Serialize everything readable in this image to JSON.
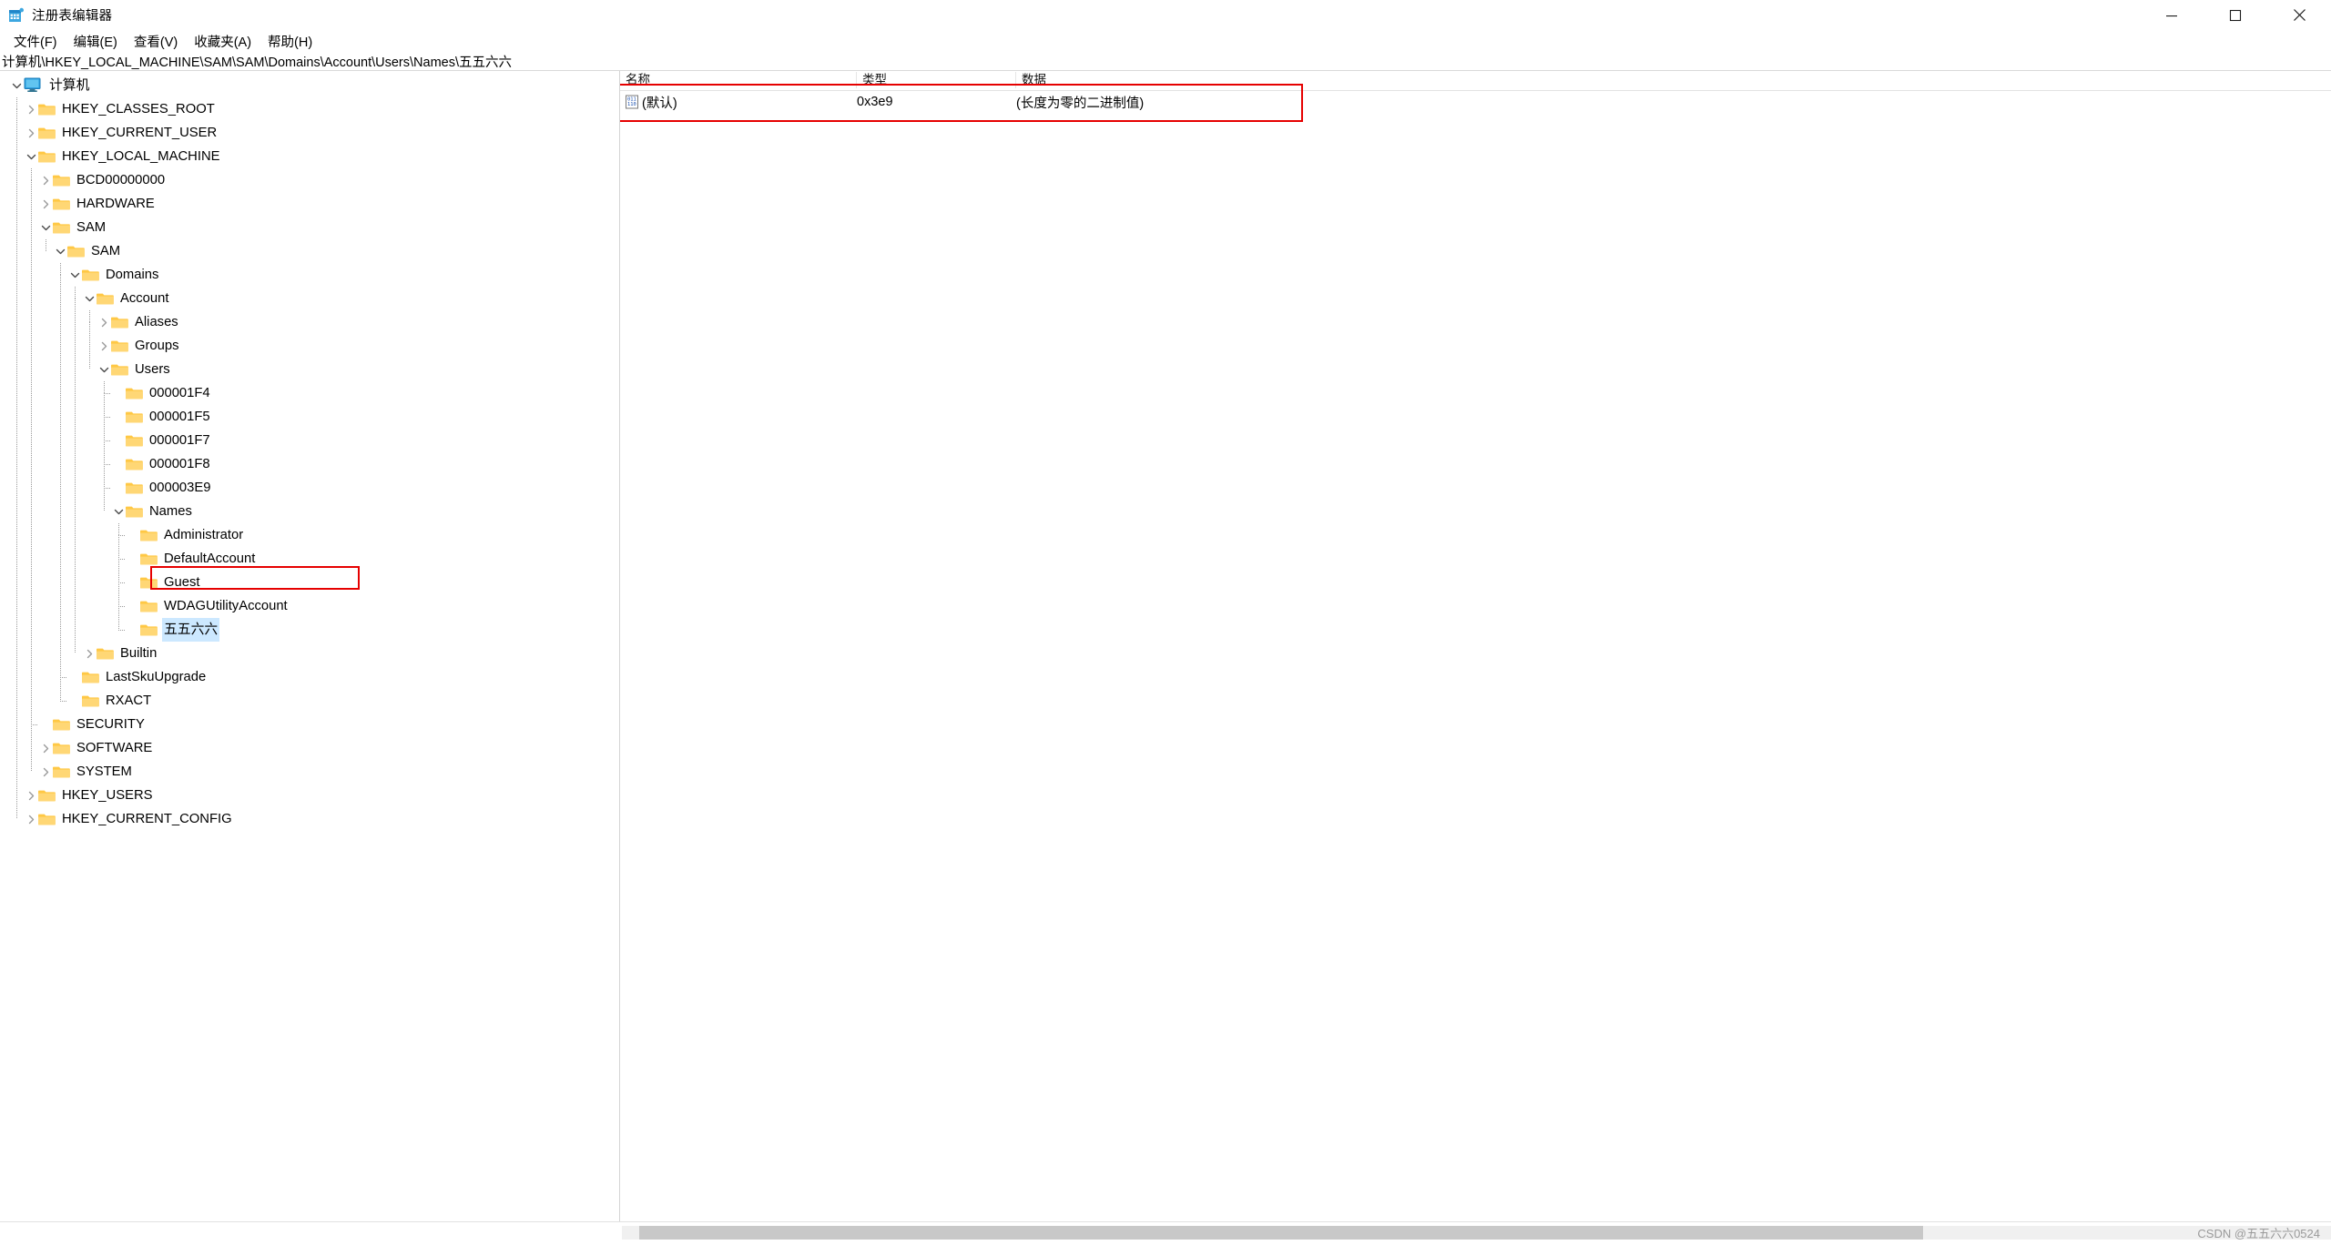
{
  "window": {
    "title": "注册表编辑器",
    "icon": "registry-editor-icon",
    "minimize_label": "─",
    "maximize_label": "☐",
    "close_label": "✕"
  },
  "menu": {
    "items": [
      {
        "label": "文件(F)",
        "name": "menu-file"
      },
      {
        "label": "编辑(E)",
        "name": "menu-edit"
      },
      {
        "label": "查看(V)",
        "name": "menu-view"
      },
      {
        "label": "收藏夹(A)",
        "name": "menu-favorites"
      },
      {
        "label": "帮助(H)",
        "name": "menu-help"
      }
    ]
  },
  "address": {
    "path": "计算机\\HKEY_LOCAL_MACHINE\\SAM\\SAM\\Domains\\Account\\Users\\Names\\五五六六"
  },
  "tree": {
    "nodes": [
      {
        "label": "计算机",
        "depth": 0,
        "state": "expanded",
        "icon": "monitor-icon",
        "selected": false
      },
      {
        "label": "HKEY_CLASSES_ROOT",
        "depth": 1,
        "state": "collapsed",
        "icon": "folder-icon",
        "selected": false
      },
      {
        "label": "HKEY_CURRENT_USER",
        "depth": 1,
        "state": "collapsed",
        "icon": "folder-icon",
        "selected": false
      },
      {
        "label": "HKEY_LOCAL_MACHINE",
        "depth": 1,
        "state": "expanded",
        "icon": "folder-icon",
        "selected": false
      },
      {
        "label": "BCD00000000",
        "depth": 2,
        "state": "collapsed",
        "icon": "folder-icon",
        "selected": false
      },
      {
        "label": "HARDWARE",
        "depth": 2,
        "state": "collapsed",
        "icon": "folder-icon",
        "selected": false
      },
      {
        "label": "SAM",
        "depth": 2,
        "state": "expanded",
        "icon": "folder-icon",
        "selected": false
      },
      {
        "label": "SAM",
        "depth": 3,
        "state": "expanded",
        "icon": "folder-icon",
        "selected": false
      },
      {
        "label": "Domains",
        "depth": 4,
        "state": "expanded",
        "icon": "folder-icon",
        "selected": false
      },
      {
        "label": "Account",
        "depth": 5,
        "state": "expanded",
        "icon": "folder-icon",
        "selected": false
      },
      {
        "label": "Aliases",
        "depth": 6,
        "state": "collapsed",
        "icon": "folder-icon",
        "selected": false
      },
      {
        "label": "Groups",
        "depth": 6,
        "state": "collapsed",
        "icon": "folder-icon",
        "selected": false
      },
      {
        "label": "Users",
        "depth": 6,
        "state": "expanded",
        "icon": "folder-icon",
        "selected": false
      },
      {
        "label": "000001F4",
        "depth": 7,
        "state": "leaf",
        "icon": "folder-icon",
        "selected": false
      },
      {
        "label": "000001F5",
        "depth": 7,
        "state": "leaf",
        "icon": "folder-icon",
        "selected": false
      },
      {
        "label": "000001F7",
        "depth": 7,
        "state": "leaf",
        "icon": "folder-icon",
        "selected": false
      },
      {
        "label": "000001F8",
        "depth": 7,
        "state": "leaf",
        "icon": "folder-icon",
        "selected": false
      },
      {
        "label": "000003E9",
        "depth": 7,
        "state": "leaf",
        "icon": "folder-icon",
        "selected": false
      },
      {
        "label": "Names",
        "depth": 7,
        "state": "expanded",
        "icon": "folder-icon",
        "selected": false
      },
      {
        "label": "Administrator",
        "depth": 8,
        "state": "leaf",
        "icon": "folder-icon",
        "selected": false
      },
      {
        "label": "DefaultAccount",
        "depth": 8,
        "state": "leaf",
        "icon": "folder-icon",
        "selected": false
      },
      {
        "label": "Guest",
        "depth": 8,
        "state": "leaf",
        "icon": "folder-icon",
        "selected": false
      },
      {
        "label": "WDAGUtilityAccount",
        "depth": 8,
        "state": "leaf",
        "icon": "folder-icon",
        "selected": false
      },
      {
        "label": "五五六六",
        "depth": 8,
        "state": "leaf",
        "icon": "folder-icon",
        "selected": true
      },
      {
        "label": "Builtin",
        "depth": 5,
        "state": "collapsed",
        "icon": "folder-icon",
        "selected": false
      },
      {
        "label": "LastSkuUpgrade",
        "depth": 4,
        "state": "leaf",
        "icon": "folder-icon",
        "selected": false
      },
      {
        "label": "RXACT",
        "depth": 4,
        "state": "leaf",
        "icon": "folder-icon",
        "selected": false
      },
      {
        "label": "SECURITY",
        "depth": 2,
        "state": "leaf",
        "icon": "folder-icon",
        "selected": false
      },
      {
        "label": "SOFTWARE",
        "depth": 2,
        "state": "collapsed",
        "icon": "folder-icon",
        "selected": false
      },
      {
        "label": "SYSTEM",
        "depth": 2,
        "state": "collapsed",
        "icon": "folder-icon",
        "selected": false
      },
      {
        "label": "HKEY_USERS",
        "depth": 1,
        "state": "collapsed",
        "icon": "folder-icon",
        "selected": false
      },
      {
        "label": "HKEY_CURRENT_CONFIG",
        "depth": 1,
        "state": "collapsed",
        "icon": "folder-icon",
        "selected": false
      }
    ]
  },
  "list": {
    "columns": [
      {
        "label": "名称",
        "name": "column-name"
      },
      {
        "label": "类型",
        "name": "column-type"
      },
      {
        "label": "数据",
        "name": "column-data"
      }
    ],
    "rows": [
      {
        "name": "(默认)",
        "type": "0x3e9",
        "data": "(长度为零的二进制值)",
        "icon": "binary-value-icon"
      }
    ]
  },
  "annotations": {
    "highlight_color": "#e60000",
    "selection_color": "#cce8ff"
  },
  "status": {
    "watermark": "CSDN @五五六六0524"
  }
}
